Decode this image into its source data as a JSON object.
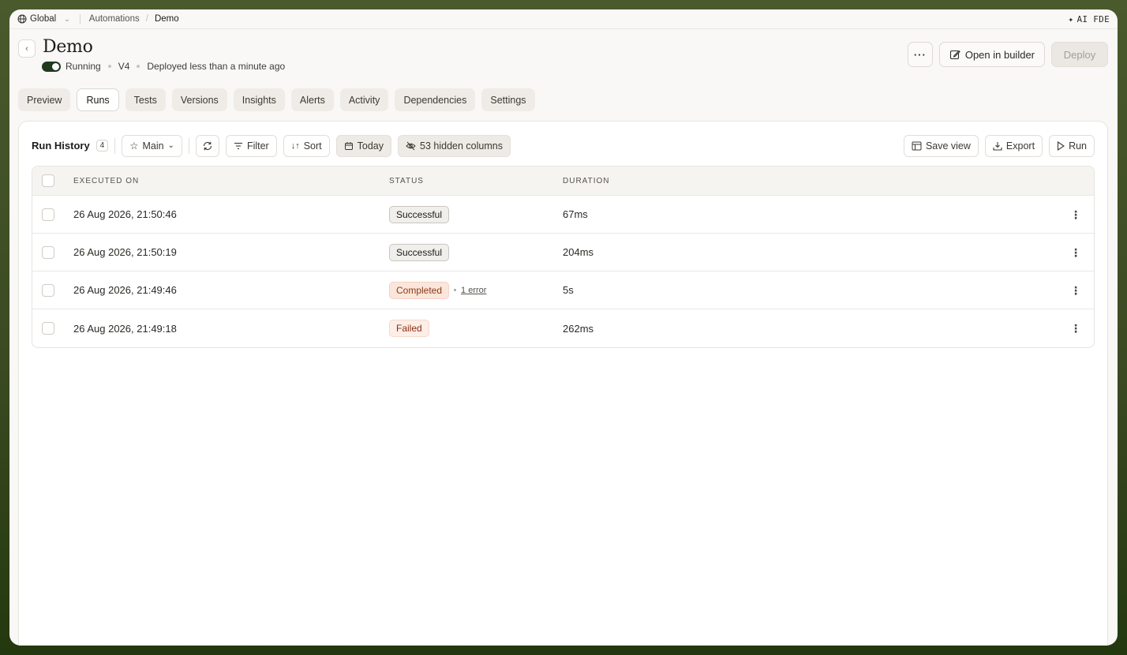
{
  "topbar": {
    "workspace": "Global",
    "breadcrumbs": [
      "Automations",
      "Demo"
    ],
    "ai_label": "AI FDE"
  },
  "header": {
    "title": "Demo",
    "status": "Running",
    "version": "V4",
    "deployed": "Deployed less than a minute ago",
    "open_builder": "Open in builder",
    "deploy": "Deploy"
  },
  "tabs": [
    "Preview",
    "Runs",
    "Tests",
    "Versions",
    "Insights",
    "Alerts",
    "Activity",
    "Dependencies",
    "Settings"
  ],
  "active_tab": "Runs",
  "toolbar": {
    "title": "Run History",
    "count": "4",
    "view": "Main",
    "filter": "Filter",
    "sort": "Sort",
    "date": "Today",
    "hidden": "53 hidden columns",
    "save_view": "Save view",
    "export": "Export",
    "run": "Run"
  },
  "table": {
    "columns": [
      "Executed on",
      "Status",
      "Duration"
    ],
    "rows": [
      {
        "executed": "26 Aug 2026, 21:50:46",
        "status": "Successful",
        "status_type": "success",
        "error": "",
        "duration": "67ms"
      },
      {
        "executed": "26 Aug 2026, 21:50:19",
        "status": "Successful",
        "status_type": "success",
        "error": "",
        "duration": "204ms"
      },
      {
        "executed": "26 Aug 2026, 21:49:46",
        "status": "Completed",
        "status_type": "completed",
        "error": "1 error",
        "duration": "5s"
      },
      {
        "executed": "26 Aug 2026, 21:49:18",
        "status": "Failed",
        "status_type": "failed",
        "error": "",
        "duration": "262ms"
      }
    ]
  },
  "colors": {
    "running_toggle": "#1f3a1f",
    "completed_bg": "#fbe6dc",
    "failed_bg": "#fdeee7"
  }
}
